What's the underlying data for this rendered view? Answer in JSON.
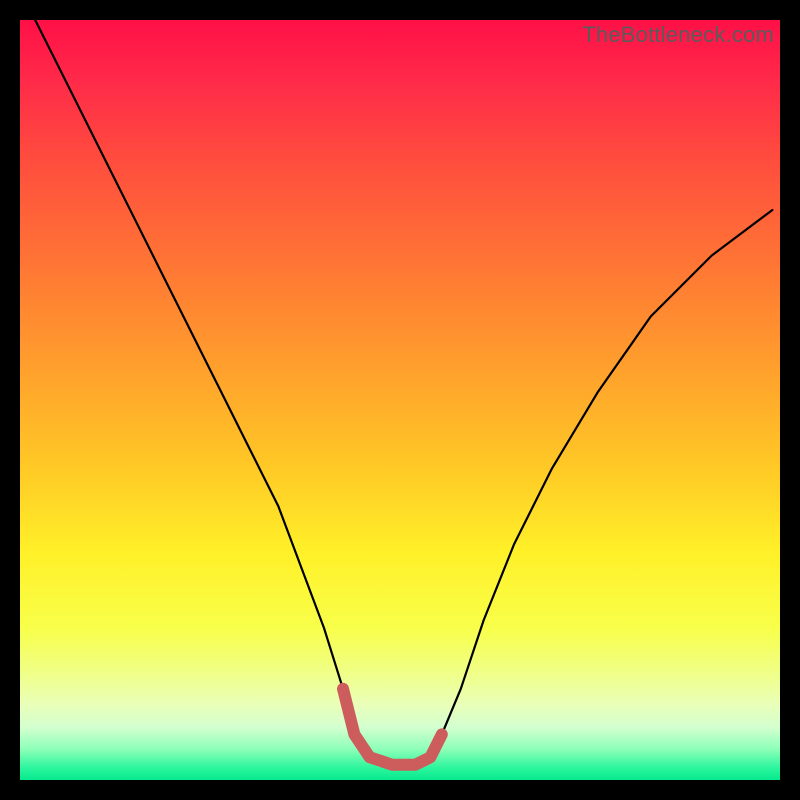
{
  "watermark": "TheBottleneck.com",
  "chart_data": {
    "type": "line",
    "title": "",
    "xlabel": "",
    "ylabel": "",
    "xlim": [
      0,
      100
    ],
    "ylim": [
      0,
      100
    ],
    "grid": false,
    "legend": false,
    "series": [
      {
        "name": "curve-main",
        "color": "#000000",
        "x": [
          2,
          6,
          10,
          14,
          18,
          22,
          26,
          30,
          34,
          37,
          40,
          42.5,
          44,
          46,
          49,
          52,
          54,
          55.5,
          58,
          61,
          65,
          70,
          76,
          83,
          91,
          99
        ],
        "values": [
          100,
          92,
          84,
          76,
          68,
          60,
          52,
          44,
          36,
          28,
          20,
          12,
          6,
          3,
          2,
          2,
          3,
          6,
          12,
          21,
          31,
          41,
          51,
          61,
          69,
          75
        ]
      },
      {
        "name": "curve-highlight",
        "color": "#cd5c5c",
        "thick": true,
        "x": [
          42.5,
          44,
          46,
          49,
          52,
          54,
          55.5
        ],
        "values": [
          12,
          6,
          3,
          2,
          2,
          3,
          6
        ]
      }
    ],
    "background_gradient_stops": [
      {
        "offset": 0.0,
        "color": "#ff1047"
      },
      {
        "offset": 0.08,
        "color": "#ff2a49"
      },
      {
        "offset": 0.18,
        "color": "#ff4b3e"
      },
      {
        "offset": 0.3,
        "color": "#ff6f36"
      },
      {
        "offset": 0.44,
        "color": "#ff9a2d"
      },
      {
        "offset": 0.58,
        "color": "#ffc626"
      },
      {
        "offset": 0.7,
        "color": "#fff028"
      },
      {
        "offset": 0.8,
        "color": "#f8ff4a"
      },
      {
        "offset": 0.86,
        "color": "#f0ff88"
      },
      {
        "offset": 0.9,
        "color": "#e9ffb8"
      },
      {
        "offset": 0.93,
        "color": "#d4ffcf"
      },
      {
        "offset": 0.96,
        "color": "#8bffb8"
      },
      {
        "offset": 0.985,
        "color": "#29f59c"
      },
      {
        "offset": 1.0,
        "color": "#07e98e"
      }
    ]
  }
}
